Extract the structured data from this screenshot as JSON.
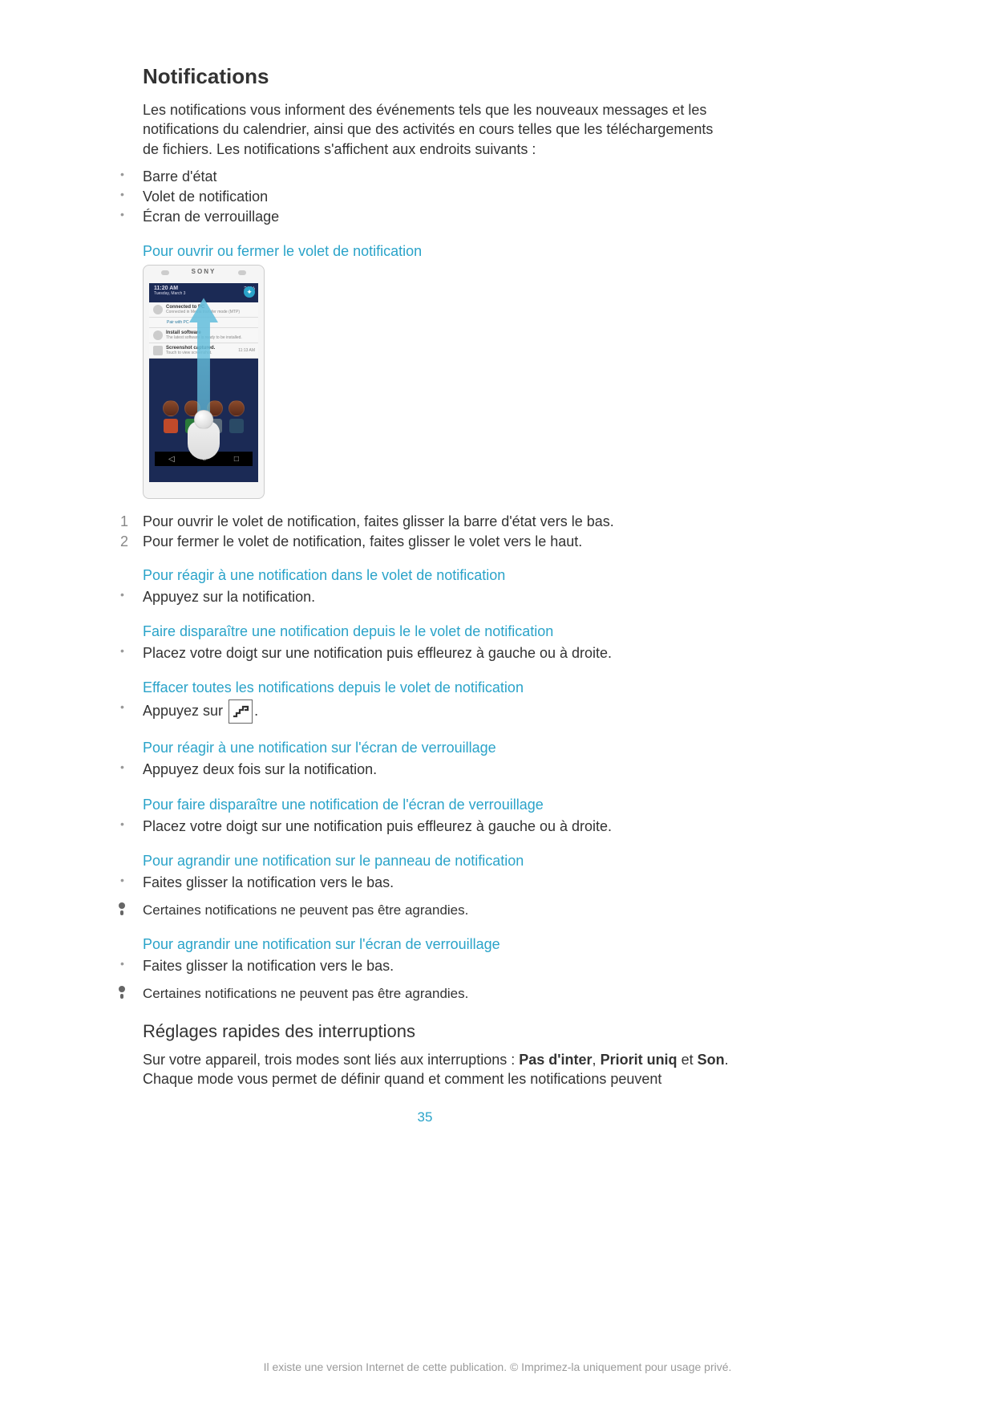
{
  "h1": "Notifications",
  "intro": "Les notifications vous informent des événements tels que les nouveaux messages et les notifications du calendrier, ainsi que des activités en cours telles que les téléchargements de fichiers. Les notifications s'affichent aux endroits suivants :",
  "locations": [
    "Barre d'état",
    "Volet de notification",
    "Écran de verrouillage"
  ],
  "sec1_h": "Pour ouvrir ou fermer le volet de notification",
  "phone": {
    "brand": "SONY",
    "status_time": "11:20 AM",
    "status_date": "Tuesday, March 3",
    "status_right": "36%",
    "n1_t": "Connected to PC",
    "n1_s": "Connected in Media transfer mode (MTP)",
    "n1b": "Pair with PC",
    "n2_t": "Install software",
    "n2_s": "The latest software is ready to be installed.",
    "n3_t": "Screenshot captured.",
    "n3_s": "Touch to view screenshot.",
    "n3_r": "11:13 AM",
    "nav_back": "◁",
    "nav_home": "○",
    "nav_recent": "□"
  },
  "steps": [
    "Pour ouvrir le volet de notification, faites glisser la barre d'état vers le bas.",
    "Pour fermer le volet de notification, faites glisser le volet vers le haut."
  ],
  "sec2_h": "Pour réagir à une notification dans le volet de notification",
  "sec2_b": "Appuyez sur la notification.",
  "sec3_h": "Faire disparaître une notification depuis le le volet de notification",
  "sec3_b": "Placez votre doigt sur une notification puis effleurez à gauche ou à droite.",
  "sec4_h": "Effacer toutes les notifications depuis le volet de notification",
  "sec4_pre": "Appuyez sur ",
  "sec4_post": ".",
  "sec5_h": "Pour réagir à une notification sur l'écran de verrouillage",
  "sec5_b": "Appuyez deux fois sur la notification.",
  "sec6_h": "Pour faire disparaître une notification de l'écran de verrouillage",
  "sec6_b": "Placez votre doigt sur une notification puis effleurez à gauche ou à droite.",
  "sec7_h": "Pour agrandir une notification sur le panneau de notification",
  "sec7_b": "Faites glisser la notification vers le bas.",
  "sec7_w": "Certaines notifications ne peuvent pas être agrandies.",
  "sec8_h": "Pour agrandir une notification sur l'écran de verrouillage",
  "sec8_b": "Faites glisser la notification vers le bas.",
  "sec8_w": "Certaines notifications ne peuvent pas être agrandies.",
  "h2": "Réglages rapides des interruptions",
  "h2_p_a": "Sur votre appareil, trois modes sont liés aux interruptions : ",
  "h2_b1": "Pas d'inter",
  "h2_sep1": ", ",
  "h2_b2": "Priorit uniq",
  "h2_sep2": " et ",
  "h2_b3": "Son",
  "h2_p_b": ". Chaque mode vous permet de définir quand et comment les notifications peuvent",
  "page_number": "35",
  "footer": "Il existe une version Internet de cette publication. © Imprimez-la uniquement pour usage privé."
}
